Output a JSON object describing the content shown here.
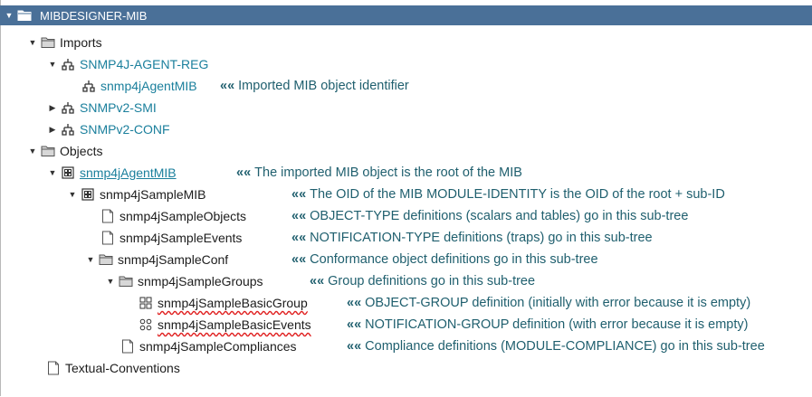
{
  "header": {
    "title": "MIBDESIGNER-MIB"
  },
  "tree": {
    "imports": "Imports",
    "agent_reg": "SNMP4J-AGENT-REG",
    "agent_mib_import": "snmp4jAgentMIB",
    "smi": "SNMPv2-SMI",
    "conf": "SNMPv2-CONF",
    "objects": "Objects",
    "agent_mib_root": "snmp4jAgentMIB",
    "sample_mib": "snmp4jSampleMIB",
    "sample_objects": "snmp4jSampleObjects",
    "sample_events": "snmp4jSampleEvents",
    "sample_conf": "snmp4jSampleConf",
    "sample_groups": "snmp4jSampleGroups",
    "basic_group": "snmp4jSampleBasicGroup",
    "basic_events": "snmp4jSampleBasicEvents",
    "compliances": "snmp4jSampleCompliances",
    "textual_conventions": "Textual-Conventions"
  },
  "annotations": {
    "marks": "«",
    "imported_identifier": "Imported MIB object identifier",
    "root": "The imported MIB object is the root of the MIB",
    "module_identity": "The OID of the MIB MODULE-IDENTITY is the OID of the root + sub-ID",
    "object_type": "OBJECT-TYPE definitions (scalars and tables) go in this sub-tree",
    "notification_type": "NOTIFICATION-TYPE definitions (traps) go in this sub-tree",
    "conformance": "Conformance object definitions go in this sub-tree",
    "group": "Group definitions go in this sub-tree",
    "object_group": "OBJECT-GROUP definition (initially with error because it is empty)",
    "notification_group": "NOTIFICATION-GROUP definition (with error because it is empty)",
    "compliance": "Compliance definitions (MODULE-COMPLIANCE) go in this sub-tree"
  },
  "colors": {
    "header_bg": "#4a7098",
    "link": "#1a7f9c",
    "annotation": "#1f5f6e",
    "error_underline": "#e02020"
  }
}
